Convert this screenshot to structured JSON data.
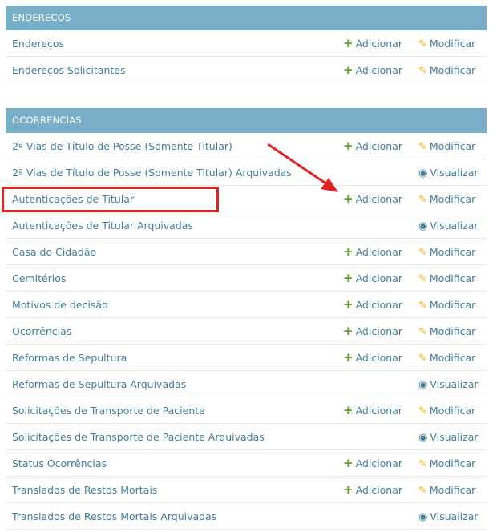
{
  "enderecos": {
    "title": "ENDERECOS",
    "rows": [
      {
        "name": "Endereços",
        "add": "Adicionar",
        "change": "Modificar"
      },
      {
        "name": "Endereços Solicitantes",
        "add": "Adicionar",
        "change": "Modificar"
      }
    ]
  },
  "ocorrencias": {
    "title": "OCORRENCIAS",
    "rows": [
      {
        "name": "2ª Vias de Título de Posse (Somente Titular)",
        "add": "Adicionar",
        "change": "Modificar"
      },
      {
        "name": "2ª Vias de Título de Posse (Somente Titular) Arquivadas",
        "view": "Visualizar"
      },
      {
        "name": "Autenticações de Titular",
        "add": "Adicionar",
        "change": "Modificar"
      },
      {
        "name": "Autenticações de Titular Arquivadas",
        "view": "Visualizar"
      },
      {
        "name": "Casa do Cidadão",
        "add": "Adicionar",
        "change": "Modificar"
      },
      {
        "name": "Cemitérios",
        "add": "Adicionar",
        "change": "Modificar"
      },
      {
        "name": "Motivos de decisão",
        "add": "Adicionar",
        "change": "Modificar"
      },
      {
        "name": "Ocorrências",
        "add": "Adicionar",
        "change": "Modificar"
      },
      {
        "name": "Reformas de Sepultura",
        "add": "Adicionar",
        "change": "Modificar"
      },
      {
        "name": "Reformas de Sepultura Arquivadas",
        "view": "Visualizar"
      },
      {
        "name": "Solicitações de Transporte de Paciente",
        "add": "Adicionar",
        "change": "Modificar"
      },
      {
        "name": "Solicitações de Transporte de Paciente Arquivadas",
        "view": "Visualizar"
      },
      {
        "name": "Status Ocorrências",
        "add": "Adicionar",
        "change": "Modificar"
      },
      {
        "name": "Translados de Restos Mortais",
        "add": "Adicionar",
        "change": "Modificar"
      },
      {
        "name": "Translados de Restos Mortais Arquivadas",
        "view": "Visualizar"
      }
    ]
  },
  "icons": {
    "add": "plus-icon",
    "change": "pencil-icon",
    "view": "eye-icon"
  },
  "colors": {
    "caption_bg": "#79aec8",
    "link": "#447e9b",
    "plus": "#5fa225",
    "pencil": "#efb80b",
    "annotation": "#e02424"
  }
}
